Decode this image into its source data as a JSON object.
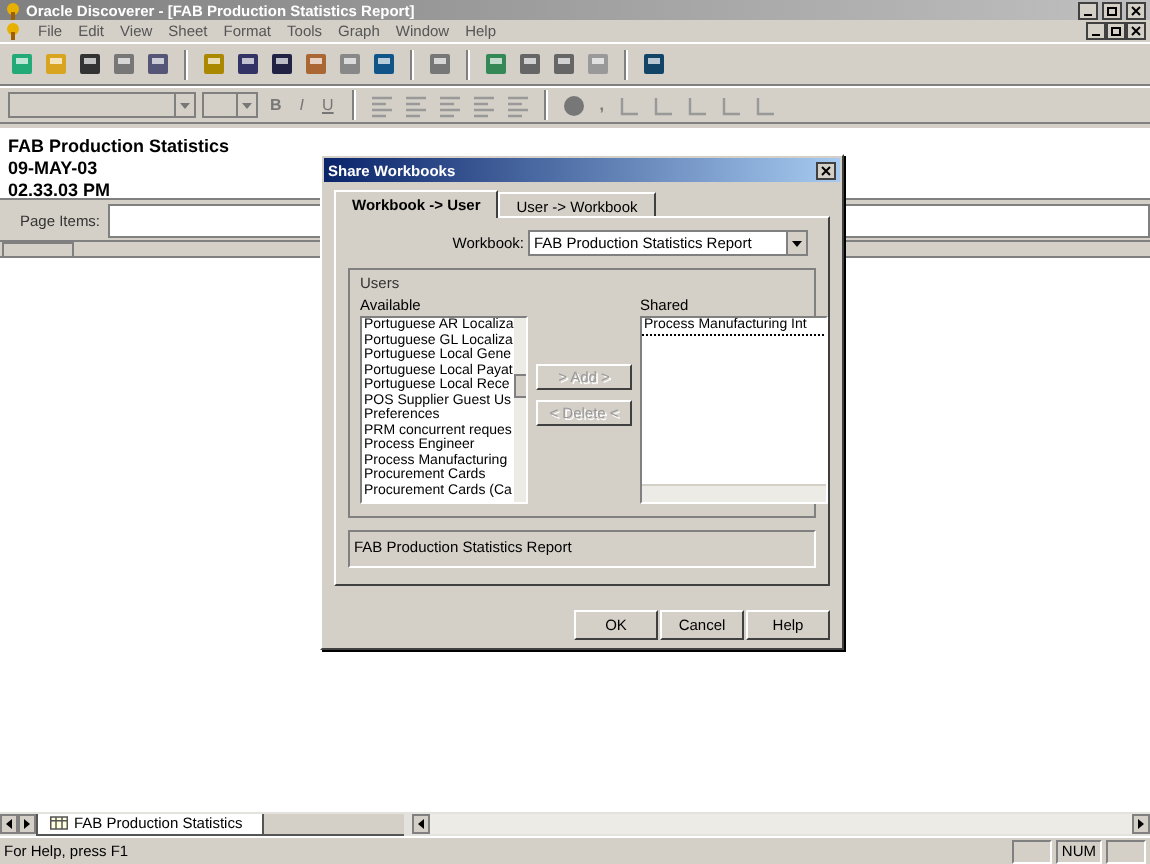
{
  "window": {
    "title": "Oracle Discoverer - [FAB Production Statistics Report]"
  },
  "menu": [
    "File",
    "Edit",
    "View",
    "Sheet",
    "Format",
    "Tools",
    "Graph",
    "Window",
    "Help"
  ],
  "format_toolbar": {
    "bold": "B",
    "italic": "I",
    "underline": "U",
    "comma": ","
  },
  "report": {
    "title": "FAB Production Statistics",
    "date": "09-MAY-03",
    "time": "02.33.03 PM"
  },
  "page_items": {
    "label": "Page Items:"
  },
  "sheet_tabs": [
    {
      "label": "FAB Production Statistics",
      "selected": true
    }
  ],
  "status_bar": {
    "text": "For Help, press F1",
    "num": "NUM"
  },
  "dialog": {
    "title": "Share Workbooks",
    "tabs": [
      {
        "label": "Workbook -> User",
        "selected": true
      },
      {
        "label": "User -> Workbook",
        "selected": false
      }
    ],
    "workbook_label": "Workbook:",
    "workbook_value": "FAB Production Statistics Report",
    "users_group": "Users",
    "available_label": "Available",
    "available": [
      "Portuguese AR Localiza",
      "Portuguese GL Localiza",
      "Portuguese Local Gene",
      "Portuguese Local Payat",
      "Portuguese Local Rece",
      "POS Supplier Guest Us",
      "Preferences",
      "PRM concurrent reques",
      "Process Engineer",
      "Process Manufacturing",
      "Procurement Cards",
      "Procurement Cards (Ca"
    ],
    "shared_label": "Shared",
    "shared": [
      "Process Manufacturing Int"
    ],
    "move_buttons": [
      {
        "label": "> Add >",
        "disabled": true
      },
      {
        "label": "< Delete <",
        "disabled": true
      }
    ],
    "description": "FAB Production Statistics Report",
    "buttons": [
      "OK",
      "Cancel",
      "Help"
    ]
  }
}
